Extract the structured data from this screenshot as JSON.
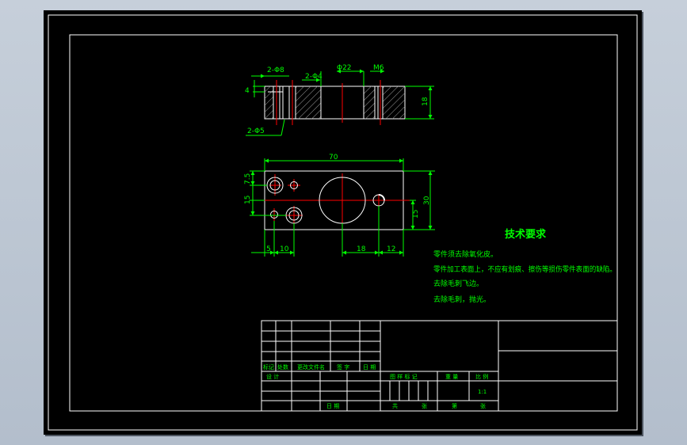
{
  "colors": {
    "background": "#000000",
    "frame": "#ffffff",
    "dimension": "#00ff00",
    "centerline": "#ff0000",
    "hatch": "#9b9b9b",
    "text": "#00ff00",
    "desktop": "#b9c3d0"
  },
  "top_view": {
    "dim_2_phi8": "2-Φ8",
    "dim_2_phi4": "2-Φ4",
    "dim_phi22": "Φ22",
    "dim_m6": "M6",
    "dim_4": "4",
    "dim_18": "18",
    "dim_2_phi5": "2-Φ5"
  },
  "front_view": {
    "dim_70": "70",
    "dim_7_5": "7.5",
    "dim_15_left": "15",
    "dim_30": "30",
    "dim_15_right": "15",
    "dim_5": "5",
    "dim_10": "10",
    "dim_18": "18",
    "dim_12": "12"
  },
  "tech": {
    "title": "技术要求",
    "lines": [
      "零件须去除氧化皮。",
      "零件加工表面上，不应有划痕、擦伤等损伤零件表面的缺陷。",
      "去除毛刺飞边。",
      "去除毛刺，抛光。"
    ]
  },
  "title_block": {
    "mark": "标记",
    "count": "处数",
    "change_doc": "更改文件名",
    "signature": "签 字",
    "date": "日 期",
    "design": "设 计",
    "date_bottom": "日 期",
    "stage_mark": "图 样 标 记",
    "weight": "重 量",
    "scale": "比 例",
    "scale_value": "1:1",
    "total": "共",
    "sheet_of": "张",
    "no": "第",
    "sheet_suffix": "张"
  }
}
